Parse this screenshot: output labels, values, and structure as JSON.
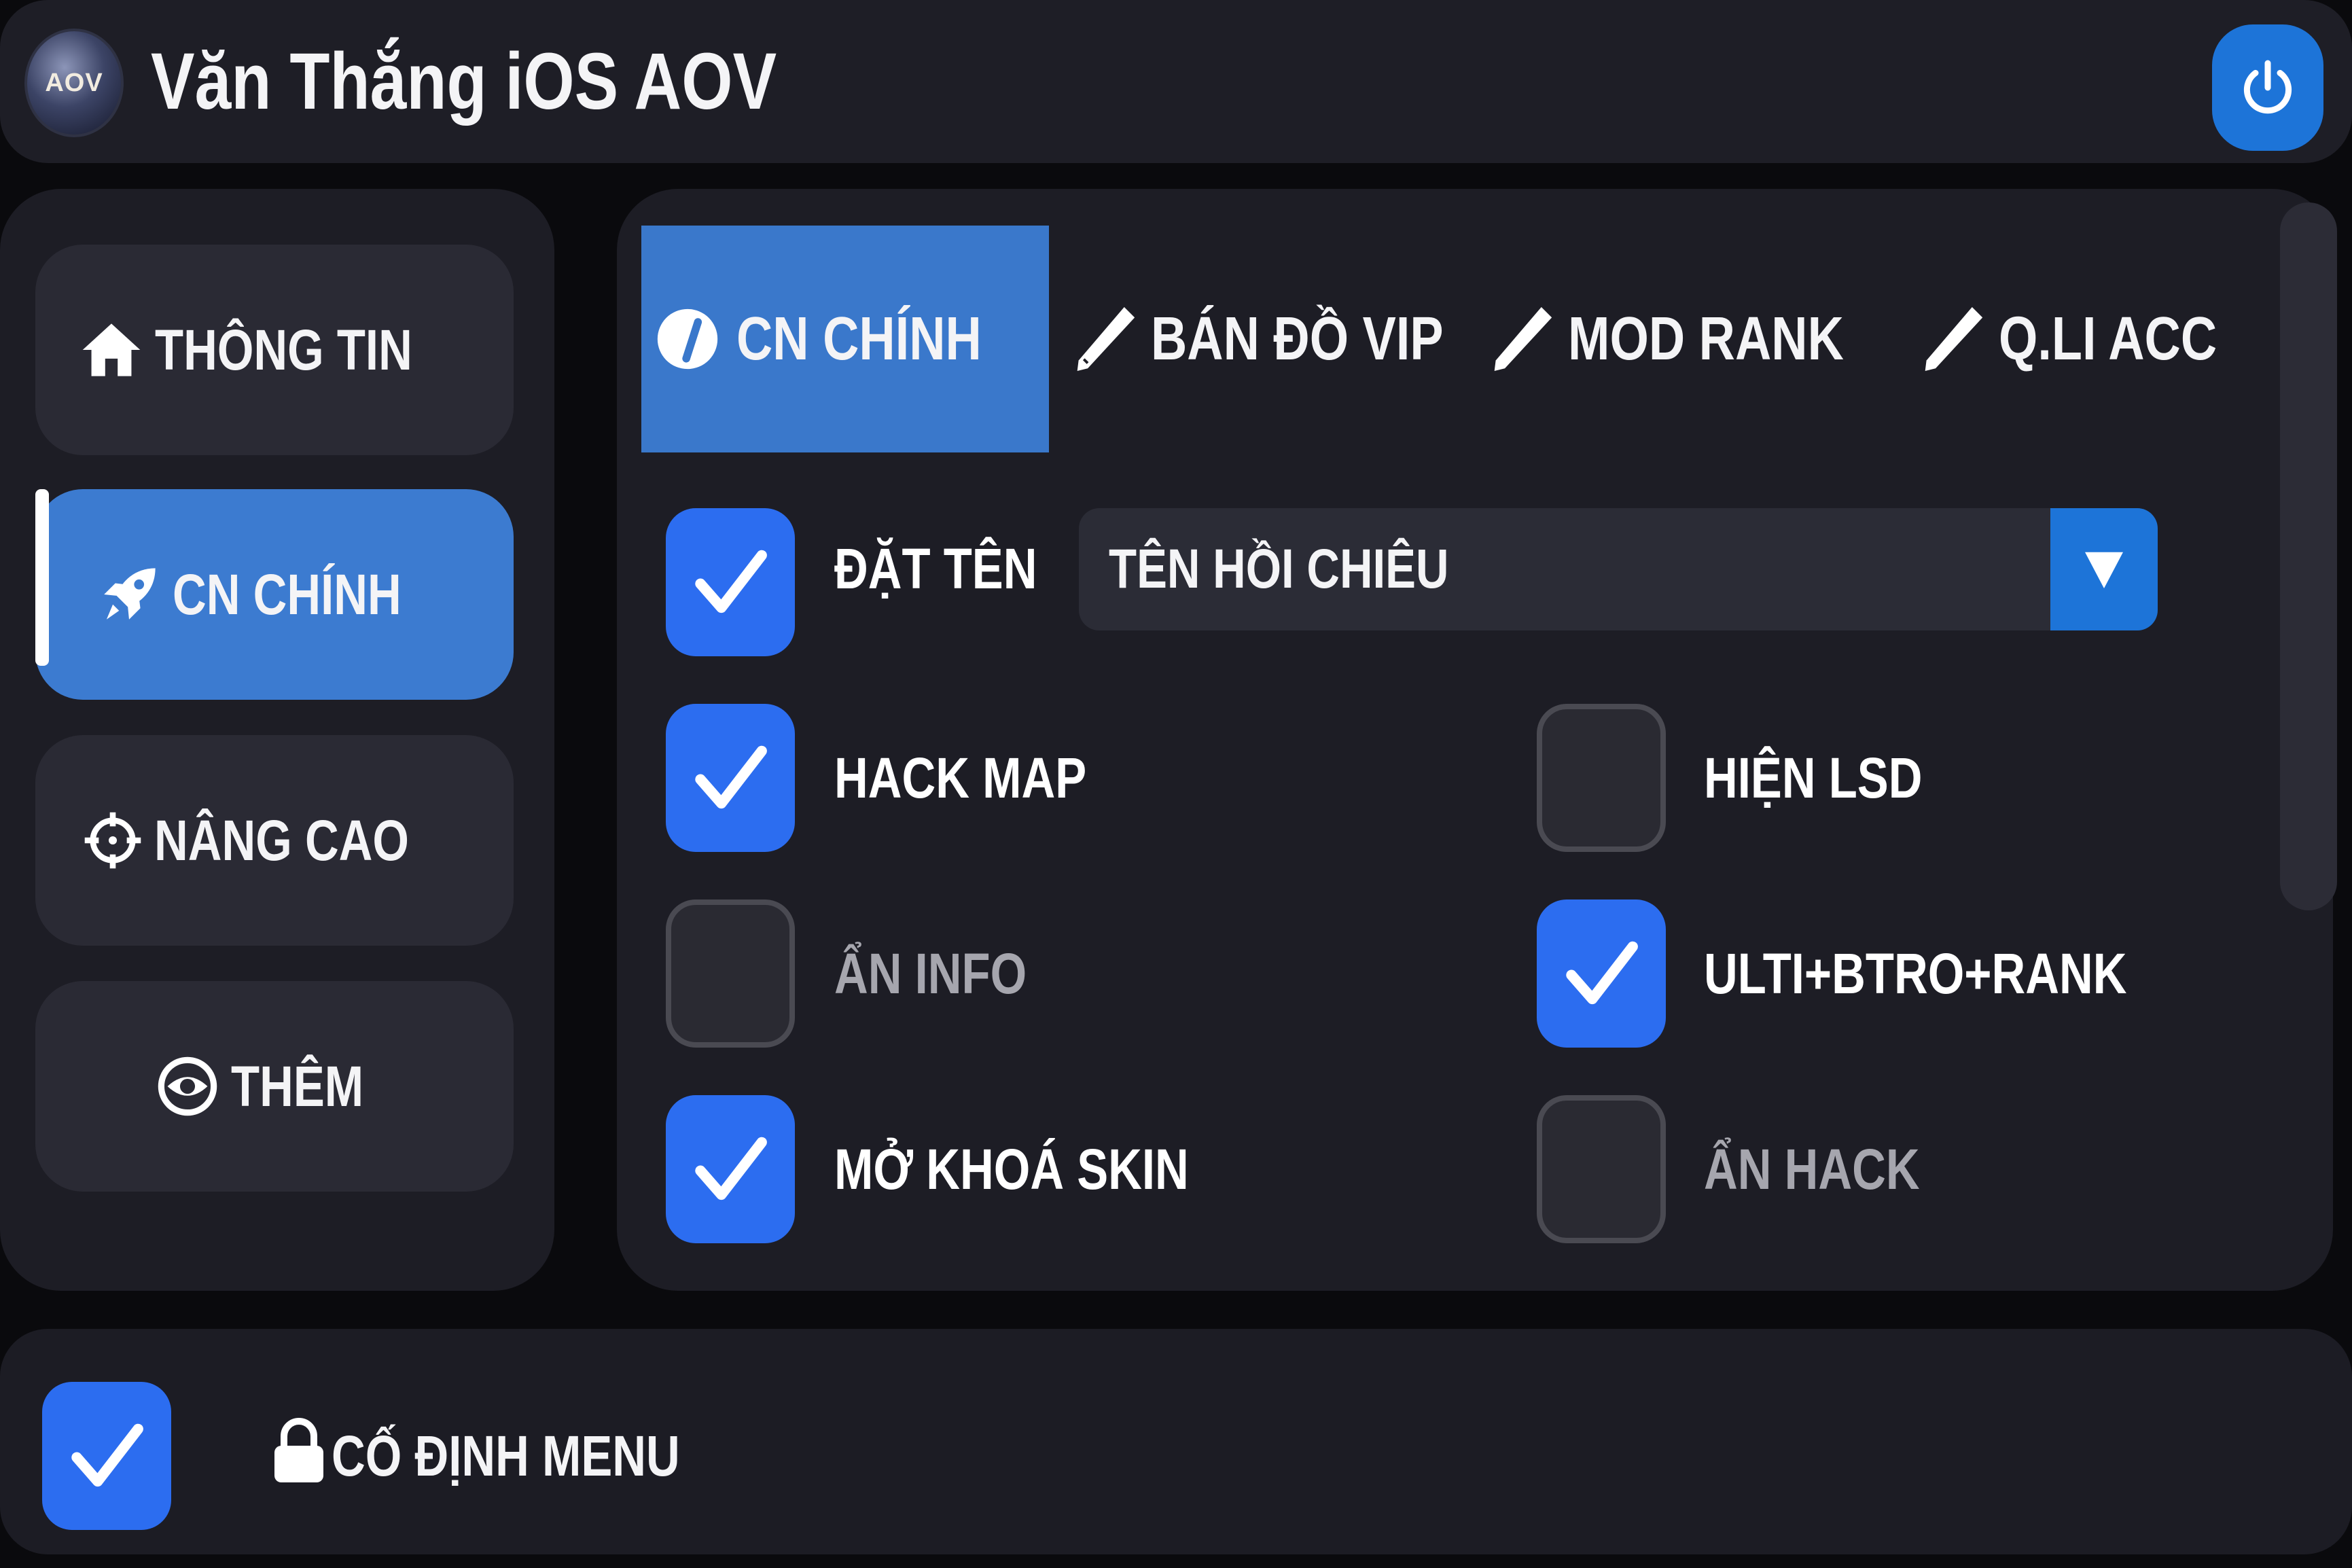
{
  "header": {
    "title": "Văn Thắng iOS AOV",
    "avatar_text": "AOV",
    "power_icon": "power-icon"
  },
  "sidebar": {
    "items": [
      {
        "label": "THÔNG TIN",
        "icon": "home-icon",
        "active": false
      },
      {
        "label": "CN CHÍNH",
        "icon": "rocket-icon",
        "active": true
      },
      {
        "label": "NÂNG CAO",
        "icon": "crosshair-icon",
        "active": false
      },
      {
        "label": "THÊM",
        "icon": "eye-icon",
        "active": false
      }
    ]
  },
  "tabs": [
    {
      "label": "CN CHÍNH",
      "icon": "gauge-icon",
      "active": true
    },
    {
      "label": "BÁN ĐỒ VIP",
      "icon": "pencil-icon",
      "active": false
    },
    {
      "label": "MOD RANK",
      "icon": "pencil-icon",
      "active": false
    },
    {
      "label": "Q.LI ACC",
      "icon": "pencil-icon",
      "active": false
    }
  ],
  "options": {
    "set_name": {
      "label": "ĐẶT TÊN",
      "checked": true,
      "select_value": "TÊN HỒI CHIÊU"
    },
    "hack_map": {
      "label": "HACK MAP",
      "checked": true
    },
    "show_lsd": {
      "label": "HIỆN LSD",
      "checked": false
    },
    "hide_info": {
      "label": "ẨN INFO",
      "checked": false
    },
    "ulti_btro_rank": {
      "label": "ULTI+BTRO+RANK",
      "checked": true
    },
    "unlock_skin": {
      "label": "MỞ KHOÁ SKIN",
      "checked": true
    },
    "hide_hack": {
      "label": "ẨN HACK",
      "checked": false
    }
  },
  "footer": {
    "label": "CỐ ĐỊNH MENU",
    "checked": true,
    "icon": "lock-icon"
  },
  "colors": {
    "accent": "#3c7bd0",
    "checkbox_on": "#2c6df0",
    "power_blue": "#1d74d8",
    "panel": "#1d1d25"
  }
}
